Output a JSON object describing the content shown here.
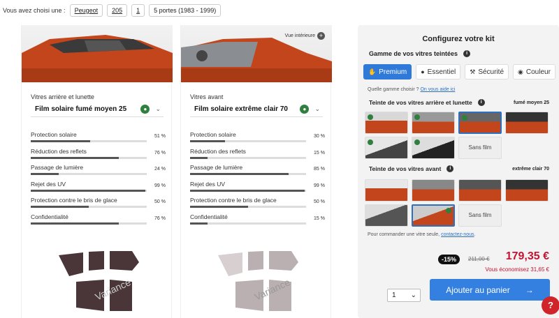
{
  "topbar": {
    "label": "Vous avez choisi une :",
    "chips": [
      "Peugeot",
      "205",
      "1",
      "5 portes (1983 - 1999)"
    ]
  },
  "left": {
    "label": "Vitres arrière et lunette",
    "selected": "Film solaire fumé moyen 25",
    "metrics": [
      {
        "name": "Protection solaire",
        "pct": "51 %",
        "value": 51
      },
      {
        "name": "Réduction des reflets",
        "pct": "76 %",
        "value": 76
      },
      {
        "name": "Passage de lumière",
        "pct": "24 %",
        "value": 24
      },
      {
        "name": "Rejet des UV",
        "pct": "99 %",
        "value": 99
      },
      {
        "name": "Protection contre le bris de glace",
        "pct": "50 %",
        "value": 50
      },
      {
        "name": "Confidentialité",
        "pct": "76 %",
        "value": 76
      }
    ]
  },
  "right": {
    "view_label": "Vue intérieure",
    "label": "Vitres avant",
    "selected": "Film solaire extrême clair 70",
    "metrics": [
      {
        "name": "Protection solaire",
        "pct": "30 %",
        "value": 30
      },
      {
        "name": "Réduction des reflets",
        "pct": "15 %",
        "value": 15
      },
      {
        "name": "Passage de lumière",
        "pct": "85 %",
        "value": 85
      },
      {
        "name": "Rejet des UV",
        "pct": "99 %",
        "value": 99
      },
      {
        "name": "Protection contre le bris de glace",
        "pct": "50 %",
        "value": 50
      },
      {
        "name": "Confidentialité",
        "pct": "15 %",
        "value": 15
      }
    ]
  },
  "panel": {
    "title": "Configurez votre kit",
    "gamme_label": "Gamme de vos vitres teintées",
    "tabs": [
      "Premium",
      "Essentiel",
      "Sécurité",
      "Couleur"
    ],
    "help_text": "Quelle gamme choisir ?",
    "help_link": "On vous aide ici",
    "rear_title": "Teinte de vos vitres arrière et lunette",
    "rear_value": "fumé moyen 25",
    "front_title": "Teinte de vos vitres avant",
    "front_value": "extrême clair 70",
    "no_film": "Sans film",
    "order_text": "Pour commander une vitre seule,",
    "order_link": "contactez-nous",
    "discount": "-15%",
    "old_price": "211,00 €",
    "new_price": "179,35 €",
    "savings": "Vous économisez 31,65 €",
    "qty": "1",
    "cart_label": "Ajouter au panier"
  },
  "colors": {
    "accent": "#3480e0",
    "price": "#c41230",
    "car": "#c2451c"
  }
}
